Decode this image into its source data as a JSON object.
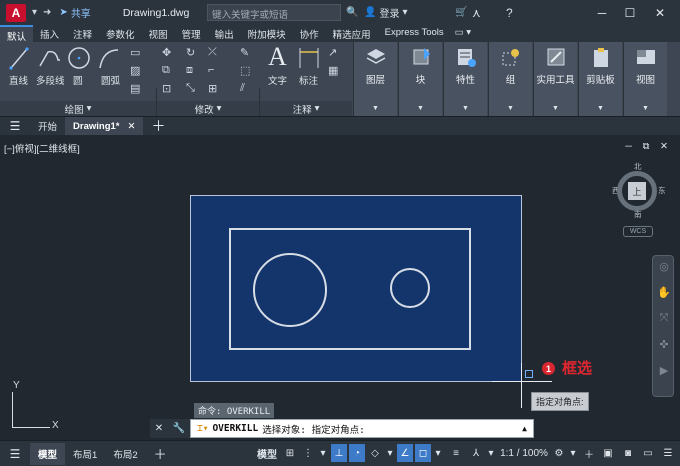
{
  "titlebar": {
    "logo": "A",
    "share": "共享",
    "doc_title": "Drawing1.dwg",
    "search_placeholder": "键入关键字或短语",
    "login": "登录"
  },
  "ribbon_tabs": [
    "默认",
    "插入",
    "注释",
    "参数化",
    "视图",
    "管理",
    "输出",
    "附加模块",
    "协作",
    "精选应用",
    "Express Tools"
  ],
  "ribbon": {
    "draw_tools": [
      "直线",
      "多段线",
      "圆",
      "圆弧"
    ],
    "panel_draw": "绘图",
    "panel_modify": "修改",
    "text": "文字",
    "dimension": "标注",
    "panel_annotate": "注释",
    "big_buttons": [
      "图层",
      "块",
      "特性",
      "组",
      "实用工具",
      "剪贴板",
      "视图"
    ]
  },
  "file_tabs": {
    "start": "开始",
    "current": "Drawing1*"
  },
  "viewport": {
    "label": "[−]俯视][二维线框]",
    "compass": {
      "north": "北",
      "south": "南",
      "east": "东",
      "west": "西",
      "face": "上"
    },
    "wcs": "WCS",
    "annotation_number": "1",
    "annotation_text": "框选",
    "tooltip": "指定对角点:",
    "cmd_history": "命令: OVERKILL",
    "ucs_x": "X",
    "ucs_y": "Y"
  },
  "command_line": {
    "command": "OVERKILL",
    "prompt": "选择对象: 指定对角点:"
  },
  "statusbar": {
    "model_tab": "模型",
    "layout1": "布局1",
    "layout2": "布局2",
    "model_btn": "模型",
    "scale": "1:1 / 100%"
  },
  "colors": {
    "selection_fill": "#14356b",
    "accent_blue": "#3c8fe0",
    "annotation_red": "#e0272f"
  }
}
